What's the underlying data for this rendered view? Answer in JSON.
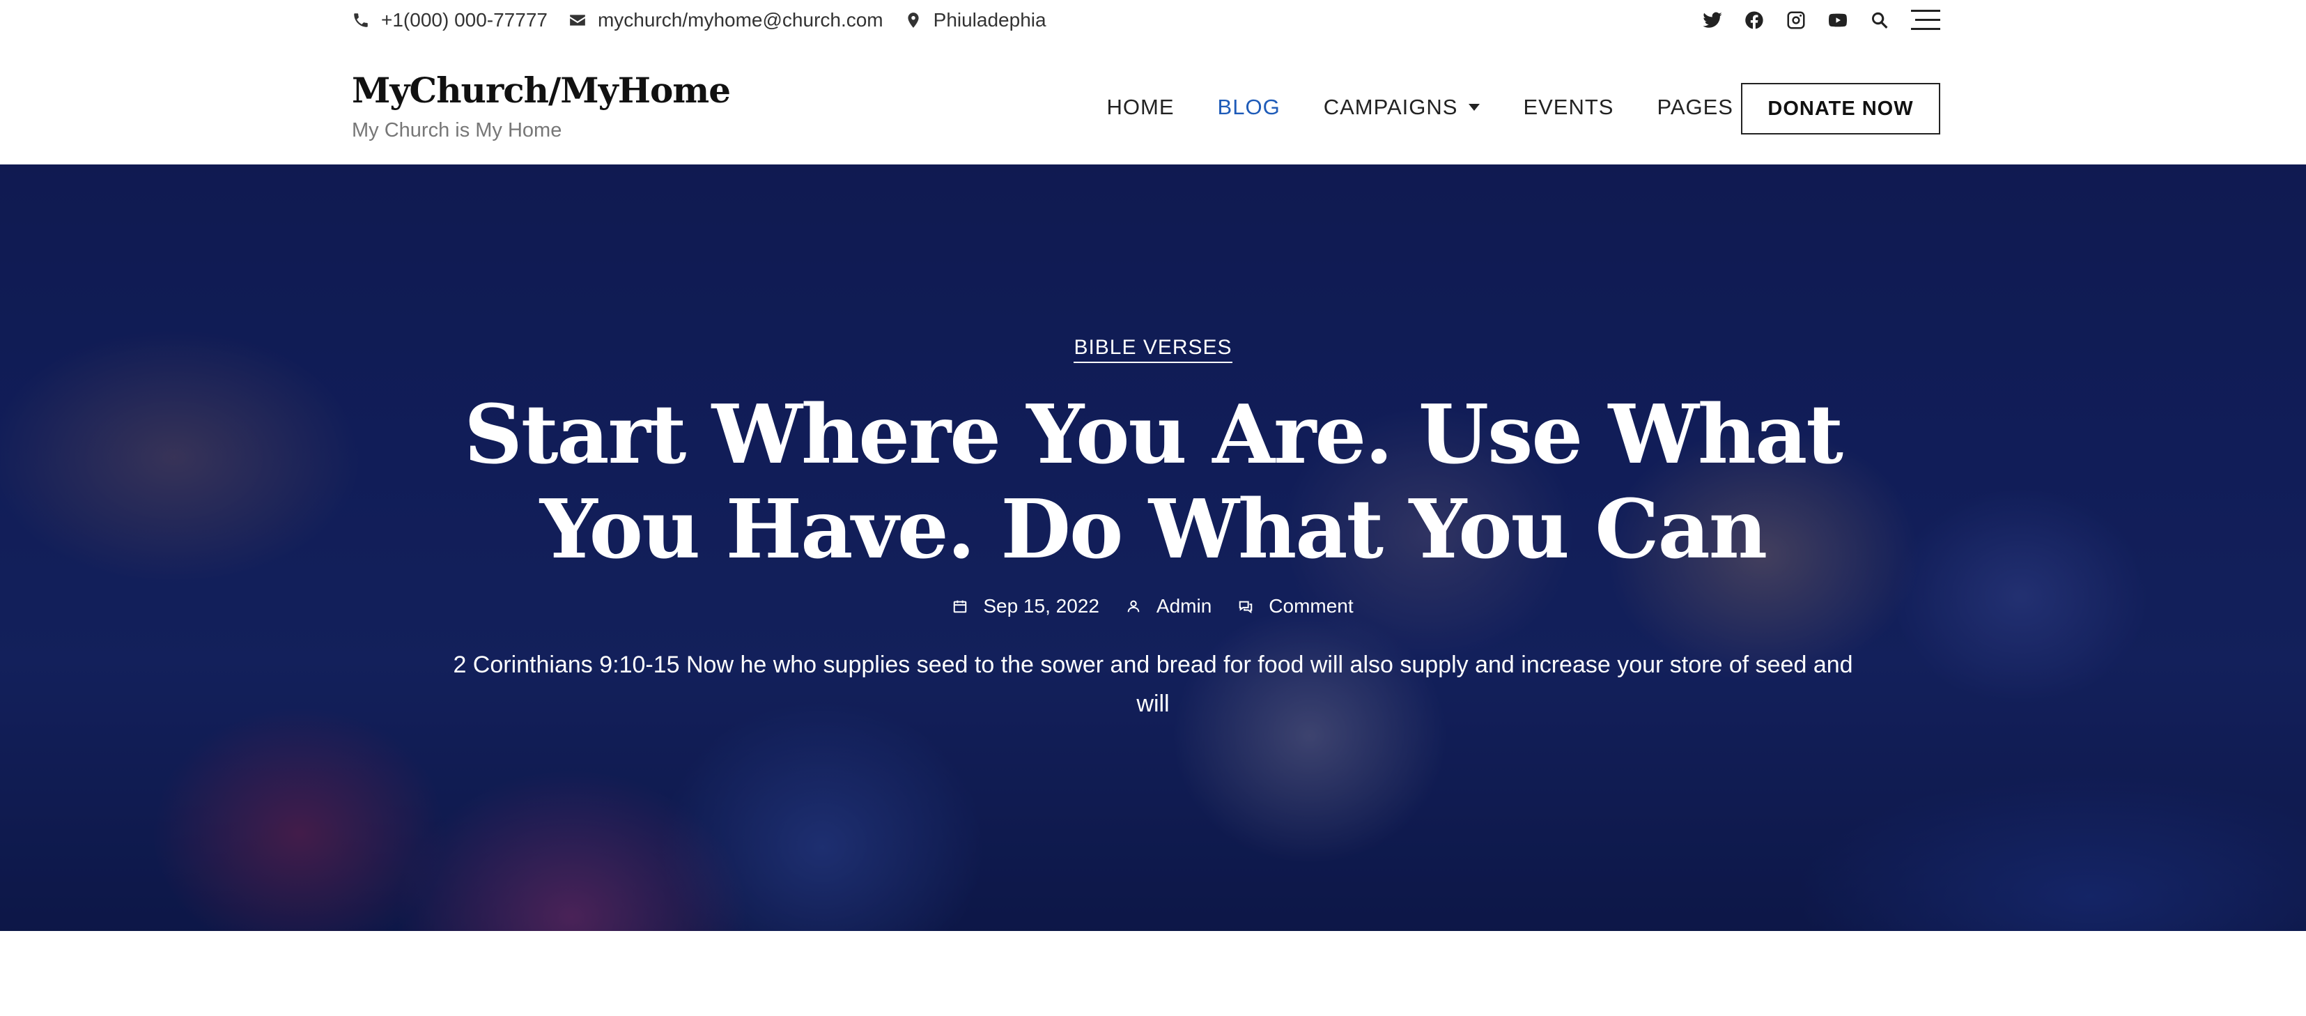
{
  "topbar": {
    "phone": "+1(000) 000-77777",
    "email": "mychurch/myhome@church.com",
    "location": "Phiuladephia",
    "icons": [
      "phone-icon",
      "envelope-icon",
      "map-marker-icon",
      "twitter-icon",
      "facebook-icon",
      "instagram-icon",
      "youtube-icon",
      "search-icon",
      "menu-icon"
    ]
  },
  "header": {
    "site_title": "MyChurch/MyHome",
    "tagline": "My Church is My Home",
    "nav": [
      {
        "label": "HOME"
      },
      {
        "label": "BLOG",
        "active": true
      },
      {
        "label": "CAMPAIGNS",
        "dropdown": true
      },
      {
        "label": "EVENTS"
      },
      {
        "label": "PAGES",
        "dropdown": true
      }
    ],
    "donate_label": "DONATE NOW",
    "accent_color": "#1e5bb8"
  },
  "hero": {
    "category": "BIBLE VERSES",
    "title": "Start Where You Are. Use What You Have. Do What You Can",
    "date": "Sep 15, 2022",
    "author": "Admin",
    "comments": "Comment",
    "excerpt": "2 Corinthians 9:10-15 Now he who supplies seed to the sower and bread for food will also supply and increase your store of seed and will",
    "overlay_color": "#14205a"
  }
}
